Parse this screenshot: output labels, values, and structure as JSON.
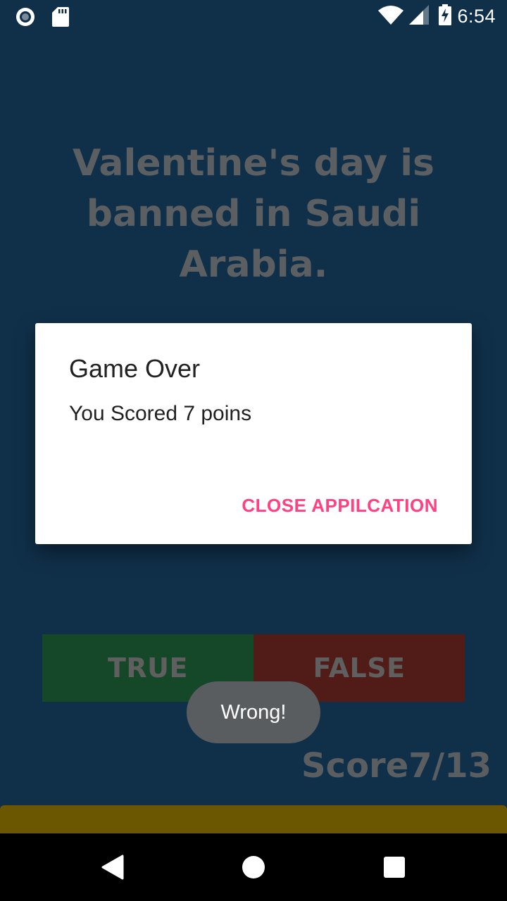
{
  "status_bar": {
    "time": "6:54",
    "icons": [
      "record-icon",
      "sd-card-icon",
      "wifi-icon",
      "signal-icon",
      "battery-charging-icon"
    ]
  },
  "quiz": {
    "question": "Valentine's day is banned in Saudi Arabia.",
    "true_label": "TRUE",
    "false_label": "FALSE",
    "score_text": "Score7/13",
    "progress_fraction": 1.0
  },
  "dialog": {
    "title": "Game Over",
    "message": "You Scored 7 poins",
    "button_label": "CLOSE APPILCATION"
  },
  "toast": {
    "text": "Wrong!"
  },
  "colors": {
    "background": "#10304a",
    "true_button": "#144828",
    "false_button": "#511c17",
    "progress": "#6b5602",
    "dialog_accent": "#ff4081"
  },
  "nav_bar": {
    "icons": [
      "back-icon",
      "home-icon",
      "recents-icon"
    ]
  }
}
